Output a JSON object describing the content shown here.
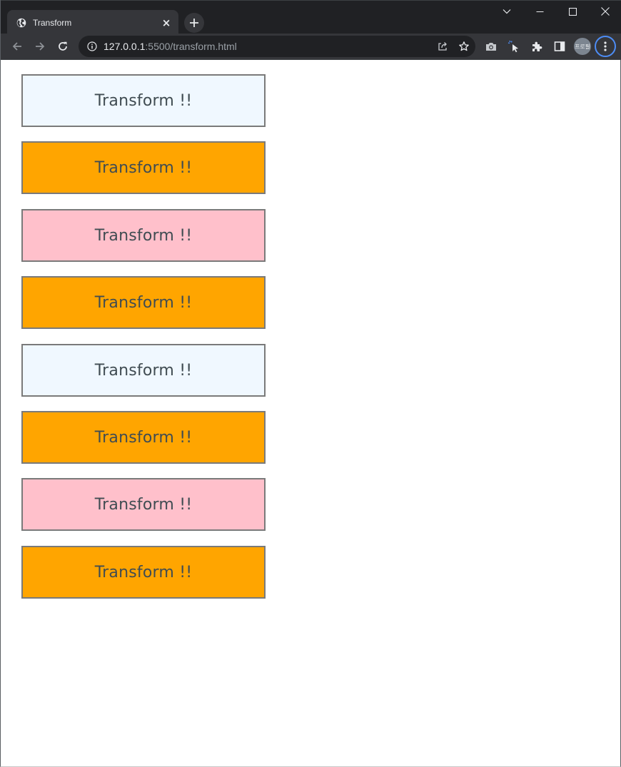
{
  "browser": {
    "tab": {
      "title": "Transform",
      "favicon": "globe-icon",
      "close": "×"
    },
    "new_tab": "new-tab-plus-icon",
    "window_controls": [
      "tab-search-icon",
      "minimize-icon",
      "maximize-icon",
      "close-icon"
    ],
    "address_bar": {
      "host": "127.0.0.1",
      "path": ":5500/transform.html"
    },
    "profile_label": "프로필",
    "colors": {
      "tabstrip_bg": "#202124",
      "toolbar_bg": "#35363a",
      "menu_ring": "#4d8df6"
    }
  },
  "page": {
    "boxes": [
      {
        "label": "Transform !!",
        "color": "#f0f8ff"
      },
      {
        "label": "Transform !!",
        "color": "#ffa500"
      },
      {
        "label": "Transform !!",
        "color": "#ffc0cb"
      },
      {
        "label": "Transform !!",
        "color": "#ffa500"
      },
      {
        "label": "Transform !!",
        "color": "#f0f8ff"
      },
      {
        "label": "Transform !!",
        "color": "#ffa500"
      },
      {
        "label": "Transform !!",
        "color": "#ffc0cb"
      },
      {
        "label": "Transform !!",
        "color": "#ffa500"
      }
    ]
  }
}
